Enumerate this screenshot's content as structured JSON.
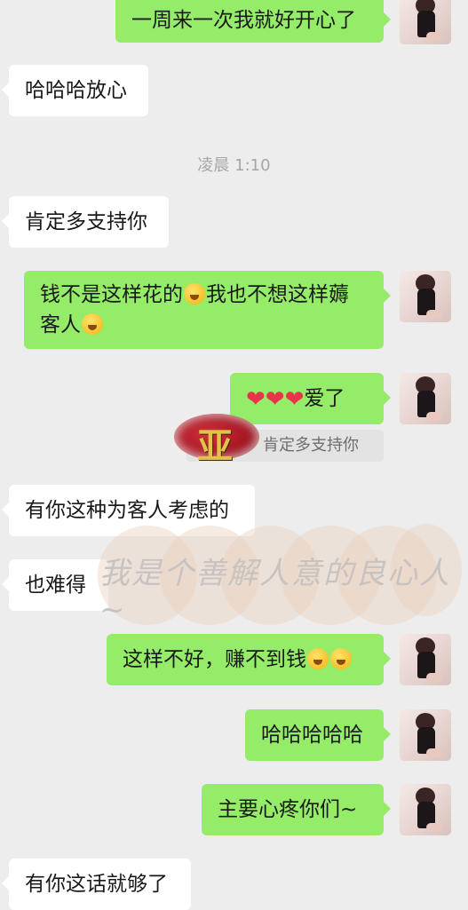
{
  "messages": [
    {
      "text": "一周来一次我就好开心了"
    },
    {
      "text": "哈哈哈放心"
    },
    {
      "text": "肯定多支持你"
    },
    {
      "text_before": "钱不是这样花的",
      "text_middle": "我也不想这样薅",
      "text_after": "客人"
    },
    {
      "text": "爱了"
    },
    {
      "text": "有你这种为客人考虑的"
    },
    {
      "text": "也难得"
    },
    {
      "text": "这样不好，赚不到钱"
    },
    {
      "text": "哈哈哈哈哈"
    },
    {
      "text": "主要心疼你们~"
    },
    {
      "text": "有你这话就够了"
    }
  ],
  "timestamp": "凌晨 1:10",
  "quote": {
    "text": "肯定多支持你"
  },
  "overlay": {
    "text": "我是个善解人意的良心人~"
  },
  "colors": {
    "self_bubble": "#95ec69",
    "other_bubble": "#ffffff",
    "background": "#ededed"
  },
  "icons": {
    "emoji": "laugh-cry-emoji",
    "heart": "red-heart"
  }
}
